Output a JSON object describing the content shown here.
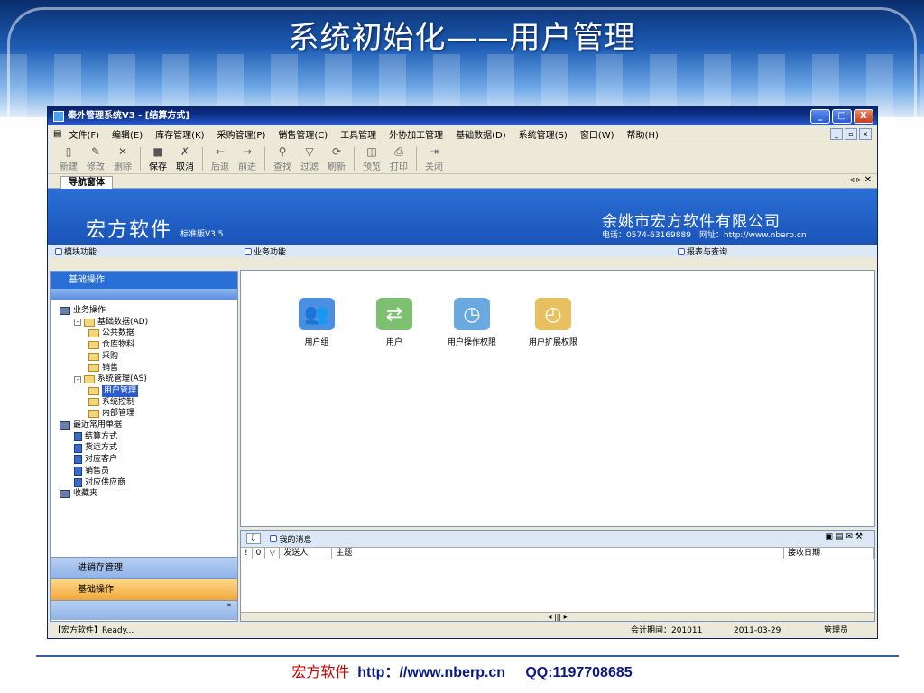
{
  "slide": {
    "title": "系统初始化——用户管理",
    "footer_brand": "宏方软件",
    "footer_url": "http：//www.nberp.cn",
    "footer_qq": "QQ:1197708685"
  },
  "window": {
    "title": "秦外管理系统V3 - [结算方式]",
    "controls": [
      "_",
      "□",
      "X"
    ]
  },
  "menu": [
    "文件(F)",
    "编辑(E)",
    "库存管理(K)",
    "采购管理(P)",
    "销售管理(C)",
    "工具管理",
    "外协加工管理",
    "基础数据(D)",
    "系统管理(S)",
    "窗口(W)",
    "帮助(H)"
  ],
  "toolbar": [
    {
      "label": "新建",
      "icon": "new-doc-icon",
      "glyph": "▯"
    },
    {
      "label": "修改",
      "icon": "edit-icon",
      "glyph": "✎"
    },
    {
      "label": "删除",
      "icon": "delete-icon",
      "glyph": "✕"
    },
    {
      "label": "保存",
      "icon": "save-icon",
      "glyph": "■"
    },
    {
      "label": "取消",
      "icon": "cancel-icon",
      "glyph": "✗"
    },
    {
      "label": "后退",
      "icon": "back-icon",
      "glyph": "←"
    },
    {
      "label": "前进",
      "icon": "forward-icon",
      "glyph": "→"
    },
    {
      "label": "查找",
      "icon": "find-icon",
      "glyph": "⚲"
    },
    {
      "label": "过滤",
      "icon": "filter-icon",
      "glyph": "▽"
    },
    {
      "label": "刷新",
      "icon": "refresh-icon",
      "glyph": "⟳"
    },
    {
      "label": "预览",
      "icon": "preview-icon",
      "glyph": "◫"
    },
    {
      "label": "打印",
      "icon": "print-icon",
      "glyph": "⎙"
    },
    {
      "label": "关闭",
      "icon": "close-door-icon",
      "glyph": "⇥"
    }
  ],
  "tab": {
    "label": "导航窗体",
    "arrows": "◃ ▹ ✕"
  },
  "header": {
    "brand": "宏方软件",
    "version": "标准版V3.5",
    "company": "余姚市宏方软件有限公司",
    "contact": "电话：0574-63169889　网址：http://www.nberp.cn"
  },
  "sections": {
    "modules": "模块功能",
    "business": "业务功能",
    "reports": "报表与查询"
  },
  "left": {
    "head": "基础操作",
    "tree": [
      {
        "label": "业务操作",
        "type": "pc",
        "level": 0
      },
      {
        "label": "基础数据(AD)",
        "type": "fold",
        "level": 1,
        "exp": "−"
      },
      {
        "label": "公共数据",
        "type": "fold",
        "level": 2
      },
      {
        "label": "仓库物料",
        "type": "fold",
        "level": 2
      },
      {
        "label": "采购",
        "type": "fold",
        "level": 2
      },
      {
        "label": "销售",
        "type": "fold",
        "level": 2
      },
      {
        "label": "系统管理(AS)",
        "type": "fold",
        "level": 1,
        "exp": "−"
      },
      {
        "label": "用户管理",
        "type": "fold",
        "level": 2,
        "sel": true
      },
      {
        "label": "系统控制",
        "type": "fold",
        "level": 2
      },
      {
        "label": "内部管理",
        "type": "fold",
        "level": 2
      },
      {
        "label": "最近常用单据",
        "type": "pc",
        "level": 0
      },
      {
        "label": "结算方式",
        "type": "doc",
        "level": 1
      },
      {
        "label": "货运方式",
        "type": "doc",
        "level": 1
      },
      {
        "label": "对应客户",
        "type": "doc",
        "level": 1
      },
      {
        "label": "销售员",
        "type": "doc",
        "level": 1
      },
      {
        "label": "对应供应商",
        "type": "doc",
        "level": 1
      },
      {
        "label": "收藏夹",
        "type": "pc",
        "level": 0
      }
    ],
    "bottom_items": [
      "进销存管理",
      "基础操作"
    ],
    "grip": "»"
  },
  "functions": [
    {
      "label": "用户组",
      "icon": "user-group-icon",
      "glyph": "👥",
      "color": "#4a8fe0"
    },
    {
      "label": "用户",
      "icon": "user-doc-icon",
      "glyph": "⇄",
      "color": "#7cc070"
    },
    {
      "label": "用户操作权限",
      "icon": "permission-clock-icon",
      "glyph": "◷",
      "color": "#6aa8e0"
    },
    {
      "label": "用户扩展权限",
      "icon": "calendar-clock-icon",
      "glyph": "◴",
      "color": "#e8c060"
    }
  ],
  "messages": {
    "title": "我的消息",
    "columns": [
      "!",
      "0",
      "▽",
      "发送人",
      "主题",
      "接收日期"
    ]
  },
  "status": {
    "left": "【宏方软件】Ready...",
    "period": "会计期间：201011",
    "date": "2011-03-29",
    "user": "管理员"
  },
  "colors": {
    "accent": "#2a6fd6",
    "title_bar": "#0a246a",
    "footer_red": "#d00000"
  }
}
